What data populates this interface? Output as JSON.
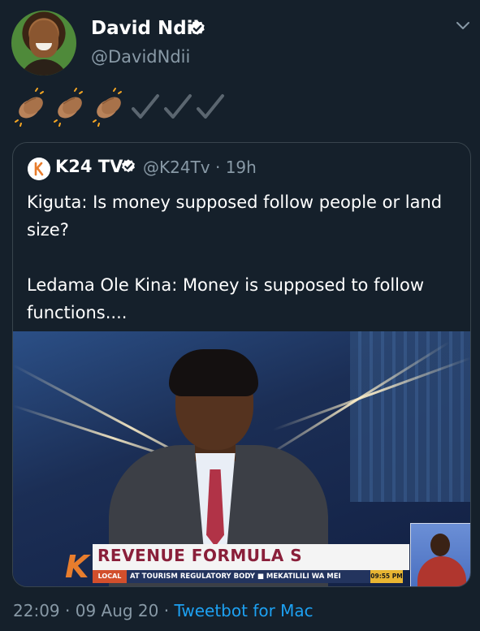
{
  "author": {
    "name": "David Ndii",
    "handle": "@DavidNdii",
    "verified": true
  },
  "tweet": {
    "emoji": [
      "clapping-hands",
      "clapping-hands",
      "clapping-hands",
      "check-mark",
      "check-mark",
      "check-mark"
    ]
  },
  "quoted": {
    "name": "K24 TV",
    "handle": "@K24Tv",
    "separator": "·",
    "time": "19h",
    "text_lines": [
      "Kiguta: Is money supposed follow people or land",
      "size?",
      "",
      "Ledama Ole Kina: Money is supposed to follow",
      "functions...."
    ],
    "media": {
      "lower_title": "REVENUE FORMULA S",
      "ticker_label": "LOCAL",
      "ticker_text": "AT TOURISM REGULATORY BODY ■ MEKATILILI WA MEI",
      "ticker_time": "09:55 PM"
    }
  },
  "footer": {
    "time": "22:09",
    "separator1": "·",
    "date": "09 Aug 20",
    "separator2": "·",
    "client": "Tweetbot for Mac"
  },
  "colors": {
    "background": "#15202b",
    "text_primary": "#ffffff",
    "text_secondary": "#8899a6",
    "link": "#1da1f2",
    "verified": "#ffffff",
    "border": "#38444d"
  }
}
